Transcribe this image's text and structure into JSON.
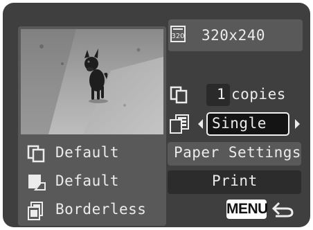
{
  "image_size": {
    "icon": "image-size-320-icon",
    "icon_label": "320",
    "value": "320x240"
  },
  "copies": {
    "icon": "copies-icon",
    "count": "1",
    "label": "copies"
  },
  "layout": {
    "icon": "layout-icon",
    "value": "Single"
  },
  "buttons": {
    "paper_settings": "Paper Settings",
    "print": "Print"
  },
  "paper_info": [
    {
      "icon": "paper-size-icon",
      "label": "Default"
    },
    {
      "icon": "paper-type-icon",
      "label": "Default"
    },
    {
      "icon": "borders-icon",
      "label": "Borderless"
    }
  ],
  "menu": {
    "label": "MENU",
    "icon": "return-arrow-icon"
  },
  "colors": {
    "screen_bg": "#3f3f3f",
    "panel_bg": "#595959",
    "selected_bg": "#141414",
    "text": "#ececec"
  }
}
